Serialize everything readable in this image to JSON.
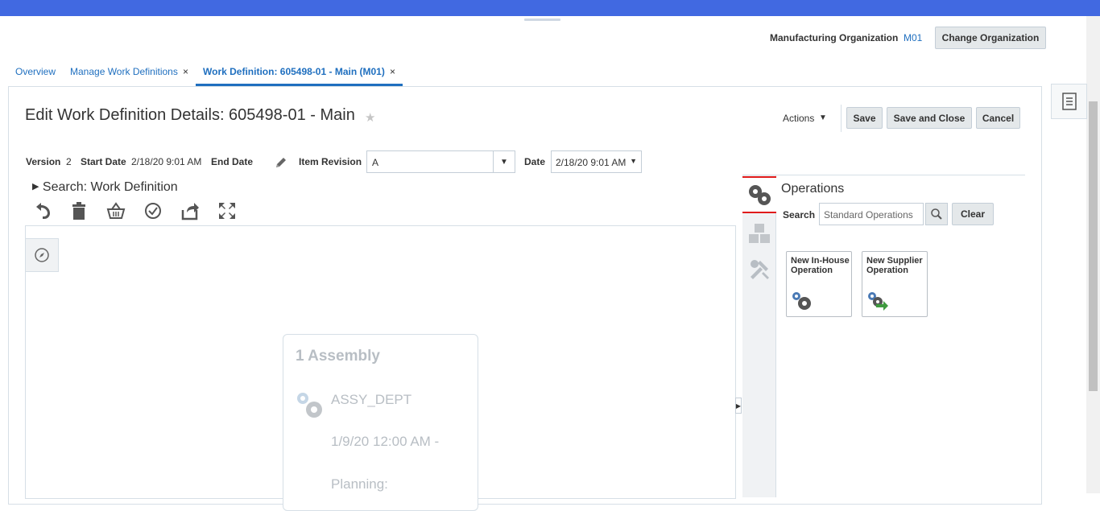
{
  "header": {
    "org_label": "Manufacturing Organization",
    "org_value": "M01",
    "change_org_button": "Change Organization"
  },
  "tabs": [
    {
      "label": "Overview",
      "closable": false,
      "active": false
    },
    {
      "label": "Manage Work Definitions",
      "closable": true,
      "active": false
    },
    {
      "label": "Work Definition: 605498-01 - Main (M01)",
      "closable": true,
      "active": true
    }
  ],
  "tab_close_glyph": "×",
  "page": {
    "title": "Edit Work Definition Details: 605498-01 - Main",
    "actions_label": "Actions",
    "save_label": "Save",
    "save_close_label": "Save and Close",
    "cancel_label": "Cancel"
  },
  "details": {
    "version_label": "Version",
    "version_value": "2",
    "start_date_label": "Start Date",
    "start_date_value": "2/18/20 9:01 AM",
    "end_date_label": "End Date",
    "item_revision_label": "Item Revision",
    "item_revision_value": "A",
    "date_label": "Date",
    "date_value": "2/18/20 9:01 AM"
  },
  "search_section": {
    "label": "Search: Work Definition"
  },
  "diagram": {
    "node_title": "1 Assembly",
    "node_department": "ASSY_DEPT",
    "node_date": "1/9/20 12:00 AM -",
    "node_planning": "Planning:"
  },
  "operations_panel": {
    "title": "Operations",
    "search_label": "Search",
    "search_placeholder": "Standard Operations",
    "clear_label": "Clear",
    "cards": [
      {
        "label": "New In-House Operation",
        "icon": "gears-icon"
      },
      {
        "label": "New Supplier Operation",
        "icon": "supplier-gears-icon"
      }
    ]
  },
  "colors": {
    "top_bar": "#4169e1",
    "link": "#1f6fbf",
    "active_palette_border": "#e01b1b"
  }
}
